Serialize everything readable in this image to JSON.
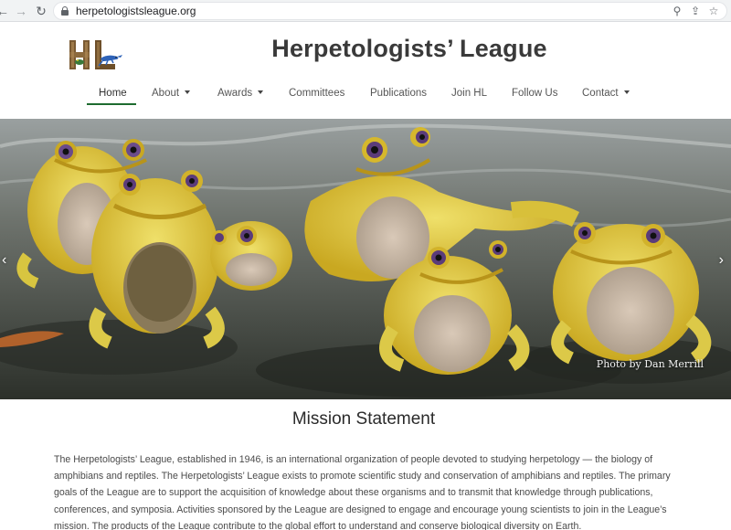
{
  "browser": {
    "url": "herpetologistsleague.org",
    "back_icon": "arrow-left-icon",
    "forward_icon": "arrow-right-icon",
    "reload_icon": "reload-icon",
    "lock_icon": "lock-icon",
    "zoom_icon": "magnifier-icon",
    "share_icon": "share-icon",
    "bookmark_icon": "star-icon"
  },
  "header": {
    "site_title": "Herpetologists’ League",
    "logo_text": "HL"
  },
  "nav": {
    "items": [
      {
        "label": "Home",
        "active": true,
        "dropdown": false
      },
      {
        "label": "About",
        "active": false,
        "dropdown": true
      },
      {
        "label": "Awards",
        "active": false,
        "dropdown": true
      },
      {
        "label": "Committees",
        "active": false,
        "dropdown": false
      },
      {
        "label": "Publications",
        "active": false,
        "dropdown": false
      },
      {
        "label": "Join HL",
        "active": false,
        "dropdown": false
      },
      {
        "label": "Follow Us",
        "active": false,
        "dropdown": false
      },
      {
        "label": "Contact",
        "active": false,
        "dropdown": true
      }
    ],
    "active_color": "#1e6b2f"
  },
  "hero": {
    "caption": "Photo by Dan Merrill",
    "prev_label": "‹",
    "next_label": "›"
  },
  "mission": {
    "title": "Mission Statement",
    "text": "The Herpetologists’ League, established in 1946, is an international organization of people devoted to studying herpetology — the biology of amphibians and reptiles. The Herpetologists’ League exists to promote scientific study and conservation of amphibians and reptiles. The primary goals of the League are to support the acquisition of knowledge about these organisms and to transmit that knowledge through publications, conferences, and symposia. Activities sponsored by the League are designed to engage and encourage young scientists to join in the League’s mission. The products of the League contribute to the global effort to understand and conserve biological diversity on Earth."
  }
}
